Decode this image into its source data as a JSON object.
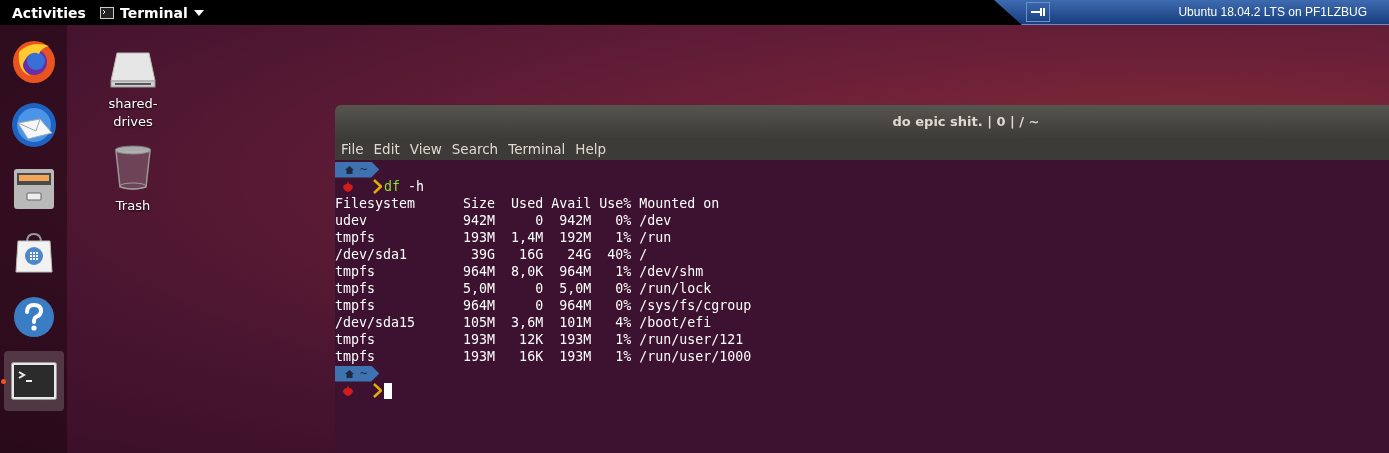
{
  "top_bar": {
    "activities": "Activities",
    "app_menu": "Terminal"
  },
  "remote_bar": {
    "title": "Ubuntu 18.04.2 LTS on PF1LZBUG"
  },
  "dock": {
    "items": [
      {
        "kind": "firefox",
        "selected": false
      },
      {
        "kind": "thunderbird",
        "selected": false
      },
      {
        "kind": "files",
        "selected": false
      },
      {
        "kind": "software",
        "selected": false
      },
      {
        "kind": "help",
        "selected": false
      },
      {
        "kind": "terminal",
        "selected": true
      }
    ]
  },
  "desktop_icons": [
    {
      "kind": "drive",
      "label": "shared-drives"
    },
    {
      "kind": "trash",
      "label": "Trash"
    }
  ],
  "terminal": {
    "title": "do epic shit. | 0 | / ~",
    "menu": [
      "File",
      "Edit",
      "View",
      "Search",
      "Terminal",
      "Help"
    ],
    "session": [
      {
        "kind": "prompt",
        "dir": "~",
        "command": "df",
        "args": "-h",
        "cursor": false
      },
      {
        "kind": "output",
        "text": "Filesystem      Size  Used Avail Use% Mounted on"
      },
      {
        "kind": "output",
        "text": "udev            942M     0  942M   0% /dev"
      },
      {
        "kind": "output",
        "text": "tmpfs           193M  1,4M  192M   1% /run"
      },
      {
        "kind": "output",
        "text": "/dev/sda1        39G   16G   24G  40% /"
      },
      {
        "kind": "output",
        "text": "tmpfs           964M  8,0K  964M   1% /dev/shm"
      },
      {
        "kind": "output",
        "text": "tmpfs           5,0M     0  5,0M   0% /run/lock"
      },
      {
        "kind": "output",
        "text": "tmpfs           964M     0  964M   0% /sys/fs/cgroup"
      },
      {
        "kind": "output",
        "text": "/dev/sda15      105M  3,6M  101M   4% /boot/efi"
      },
      {
        "kind": "output",
        "text": "tmpfs           193M   12K  193M   1% /run/user/121"
      },
      {
        "kind": "output",
        "text": "tmpfs           193M   16K  193M   1% /run/user/1000"
      },
      {
        "kind": "prompt",
        "dir": "~",
        "cursor": true
      }
    ]
  }
}
